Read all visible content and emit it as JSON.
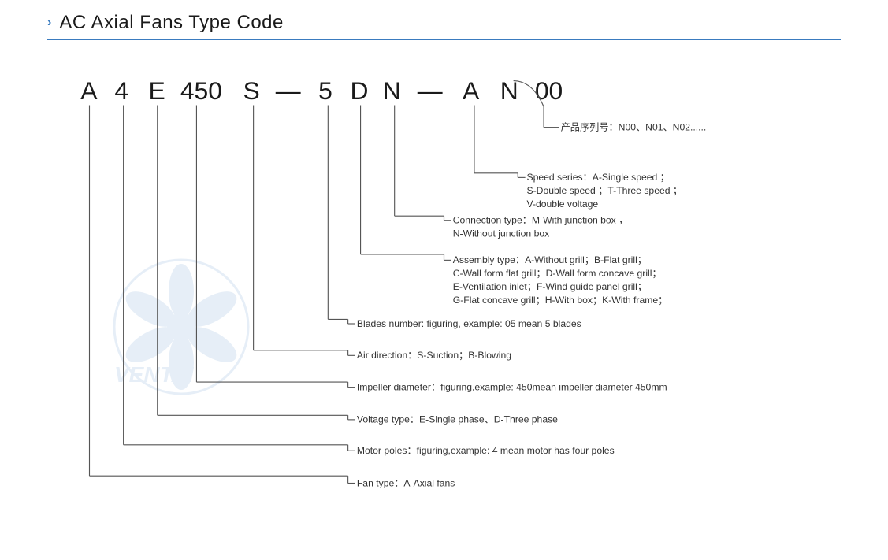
{
  "title": {
    "chevron": "›",
    "text": "AC Axial Fans Type Code"
  },
  "type_code": {
    "letters": [
      "A",
      "4",
      "E",
      "450",
      "S",
      "—",
      "5",
      "D",
      "N",
      "—",
      "A",
      "N",
      "00"
    ]
  },
  "descriptions": {
    "product_series": {
      "label": "产品序列号：",
      "value": "N00、N01、N02......"
    },
    "speed_series": {
      "label": "Speed series：",
      "value": "A-Single speed ；\nS-Double speed ；T-Three speed ；\nV-double voltage"
    },
    "connection_type": {
      "label": "Connection type：",
      "value": "M-With junction box ，\nN-Without junction box"
    },
    "assembly_type": {
      "label": "Assembly type：",
      "value": "A-Without grill；B-Flat grill；\nC-Wall form flat grill；D-Wall form concave grill；\nE-Ventilation inlet；F-Wind guide panel grill；\nG-Flat concave grill；H-With box；K-With frame；"
    },
    "blades_number": {
      "label": "Blades number：",
      "value": "figuring, example: 05 mean 5 blades"
    },
    "air_direction": {
      "label": "Air direction：",
      "value": "S-Suction；B-Blowing"
    },
    "impeller_diameter": {
      "label": "Impeller diameter：",
      "value": "figuring,example: 450mean impeller diameter 450mm"
    },
    "voltage_type": {
      "label": "Voltage type：",
      "value": "E-Single phase、D-Three phase"
    },
    "motor_poles": {
      "label": "Motor poles：",
      "value": "figuring,example: 4 mean motor has four poles"
    },
    "fan_type": {
      "label": "Fan type：",
      "value": "A-Axial fans"
    }
  },
  "colors": {
    "blue": "#3a7bbf",
    "dark": "#1a1a1a",
    "line": "#555555"
  }
}
